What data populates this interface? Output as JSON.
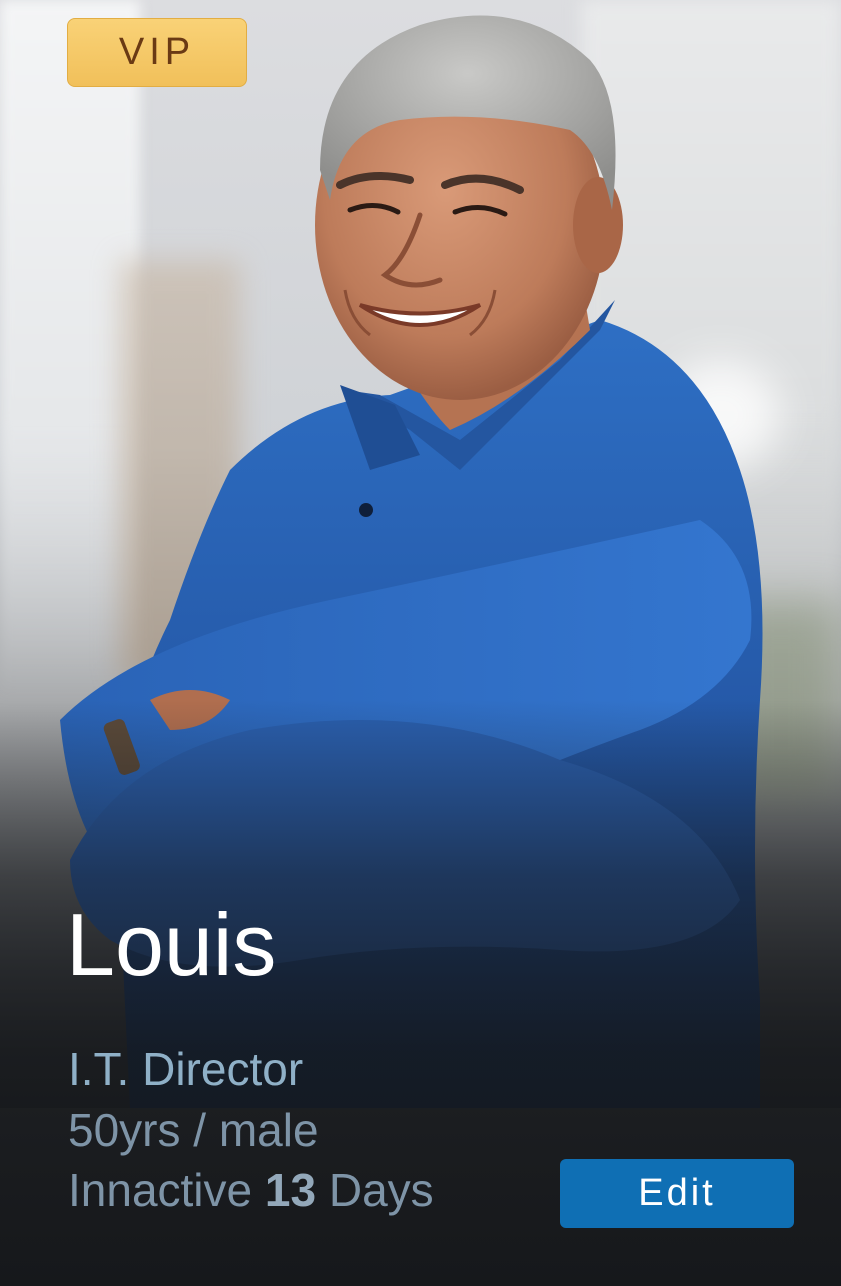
{
  "badge": {
    "label": "VIP"
  },
  "profile": {
    "name": "Louis",
    "job_title": "I.T. Director",
    "age_gender": "50yrs / male",
    "inactive_prefix": "Innactive ",
    "inactive_days": "13",
    "inactive_suffix": " Days"
  },
  "actions": {
    "edit_label": "Edit"
  },
  "colors": {
    "badge_bg": "#f5c864",
    "badge_text": "#6a3a14",
    "button_bg": "#0f6fb4",
    "name_text": "#ffffff",
    "job_title_text": "#8fb0c7",
    "meta_text": "#7e94a7"
  }
}
